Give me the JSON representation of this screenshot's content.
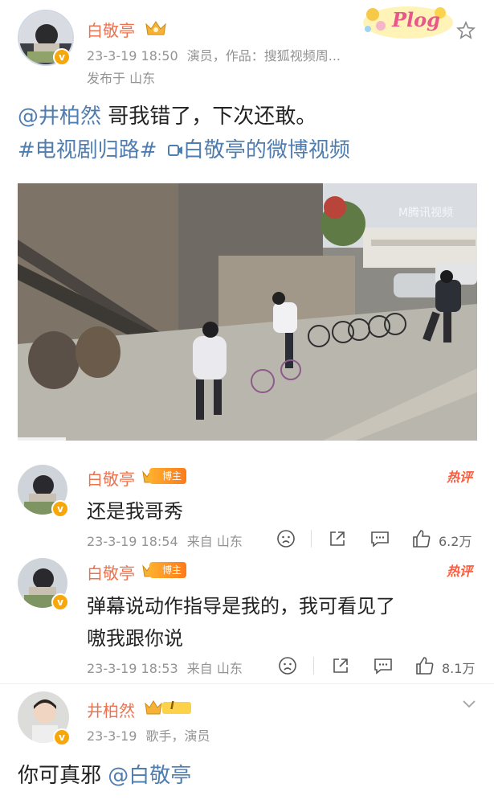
{
  "post": {
    "author": "白敬亭",
    "time": "23-3-19 18:50",
    "source": "演员，作品：搜狐视频周...",
    "location": "发布于 山东",
    "mention": "@井柏然",
    "body_text": " 哥我错了，下次还敢。",
    "topic": "#电视剧归路#",
    "video_link": "白敬亭的微博视频",
    "decor_text": "Plog"
  },
  "video": {
    "watermark": "M腾讯视频"
  },
  "comments": [
    {
      "author": "白敬亭",
      "tag": "博主",
      "hot": "热评",
      "text": "还是我哥秀",
      "time": "23-3-19 18:54",
      "from": "来自 山东",
      "likes": "6.2万"
    },
    {
      "author": "白敬亭",
      "tag": "博主",
      "hot": "热评",
      "text_line1": "弹幕说动作指导是我的，我可看见了",
      "text_line2": "嗷我跟你说",
      "time": "23-3-19 18:53",
      "from": "来自 山东",
      "likes": "8.1万"
    }
  ],
  "reply": {
    "author": "井柏然",
    "level": "I",
    "time": "23-3-19",
    "desc": "歌手，演员",
    "text": "你可真邪 ",
    "mention": "@白敬亭"
  },
  "colors": {
    "username": "#eb7350",
    "link": "#507daf",
    "hot": "#ff5a3c",
    "meta": "#939393"
  }
}
